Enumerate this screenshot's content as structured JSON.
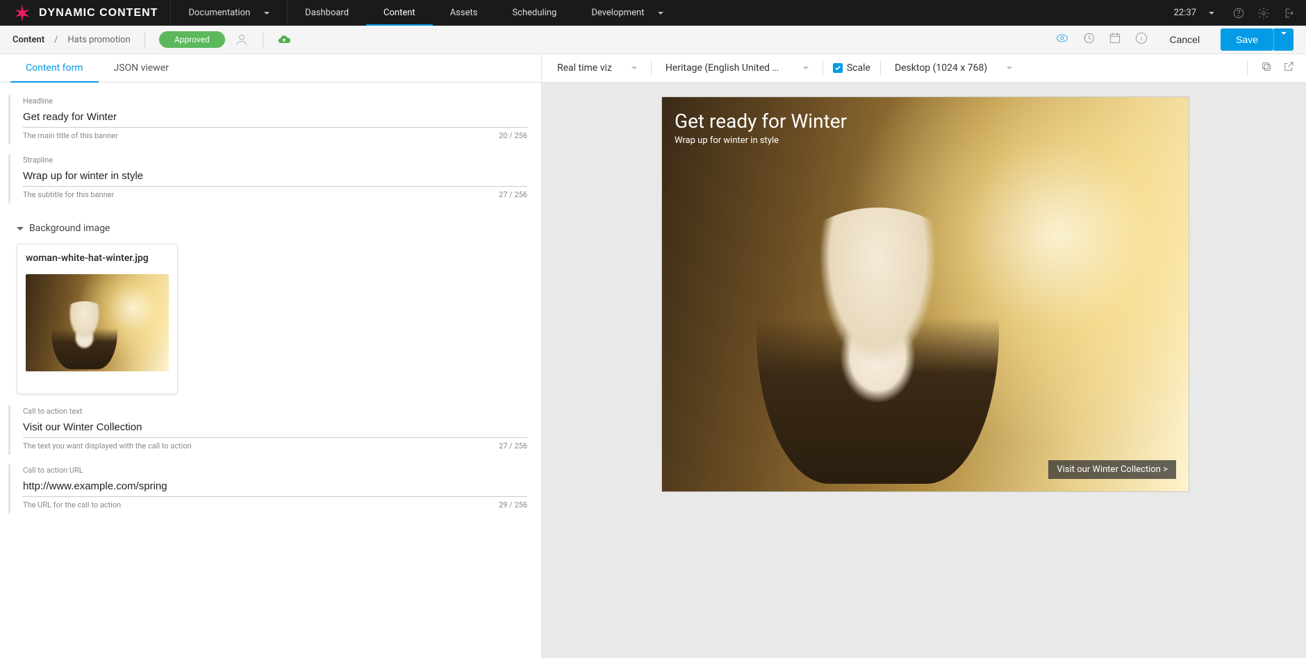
{
  "brand": "DYNAMIC CONTENT",
  "topnav": {
    "documentation": "Documentation",
    "dashboard": "Dashboard",
    "content": "Content",
    "assets": "Assets",
    "scheduling": "Scheduling",
    "development": "Development"
  },
  "clock": "22:37",
  "breadcrumb": {
    "root": "Content",
    "item": "Hats promotion"
  },
  "status_pill": "Approved",
  "actions": {
    "cancel": "Cancel",
    "save": "Save"
  },
  "form_tabs": {
    "content_form": "Content form",
    "json_viewer": "JSON viewer"
  },
  "fields": {
    "headline": {
      "label": "Headline",
      "value": "Get ready for Winter",
      "help": "The main title of this banner",
      "counter": "20 / 256"
    },
    "strapline": {
      "label": "Strapline",
      "value": "Wrap up for winter in style",
      "help": "The subtitle for this banner",
      "counter": "27 / 256"
    },
    "bgimage": {
      "section_title": "Background image",
      "filename": "woman-white-hat-winter.jpg"
    },
    "cta_text": {
      "label": "Call to action text",
      "value": "Visit our Winter Collection",
      "help": "The text you want displayed with the call to action",
      "counter": "27 / 256"
    },
    "cta_url": {
      "label": "Call to action URL",
      "value": "http://www.example.com/spring",
      "help": "The URL for the call to action",
      "counter": "29 / 256"
    }
  },
  "preview_toolbar": {
    "viz_label": "Real time viz",
    "locale": "Heritage (English United Ki…",
    "scale_label": "Scale",
    "device": "Desktop (1024 x 768)"
  },
  "preview_content": {
    "headline": "Get ready for Winter",
    "strapline": "Wrap up for winter in style",
    "cta": "Visit our Winter Collection >"
  }
}
